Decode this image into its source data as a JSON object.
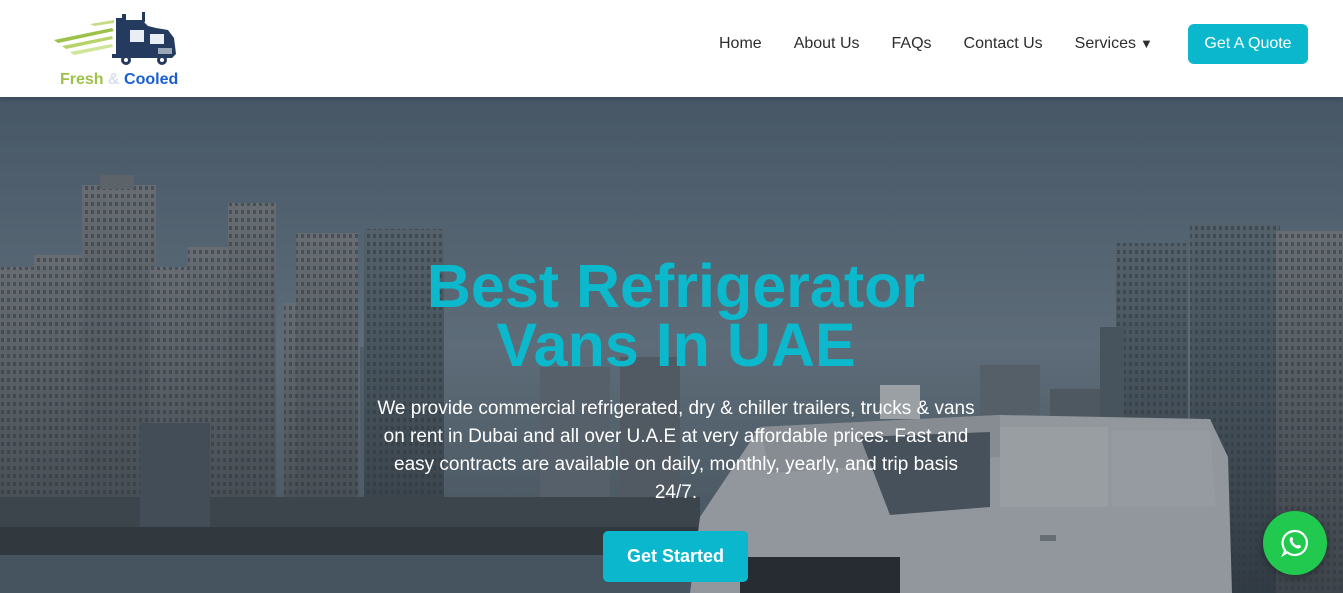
{
  "logo": {
    "word1": "Fresh",
    "amp": "&",
    "word2": "Cooled"
  },
  "nav": {
    "items": [
      "Home",
      "About Us",
      "FAQs",
      "Contact Us",
      "Services"
    ],
    "services_caret": "▼"
  },
  "quote_button": "Get A Quote",
  "hero": {
    "title_line1": "Best Refrigerator",
    "title_line2": "Vans In UAE",
    "description": "We provide commercial refrigerated, dry & chiller trailers, trucks & vans on rent in Dubai and all over U.A.E at very affordable prices. Fast and easy contracts are available on daily, monthly, yearly, and trip basis 24/7.",
    "cta": "Get Started"
  },
  "colors": {
    "accent": "#0ab7cc",
    "logo_green": "#9dc24a",
    "logo_blue": "#1a5fd0",
    "whatsapp_green": "#22c94f"
  },
  "icons": [
    "truck-logo-icon",
    "whatsapp-icon",
    "caret-down-icon"
  ]
}
